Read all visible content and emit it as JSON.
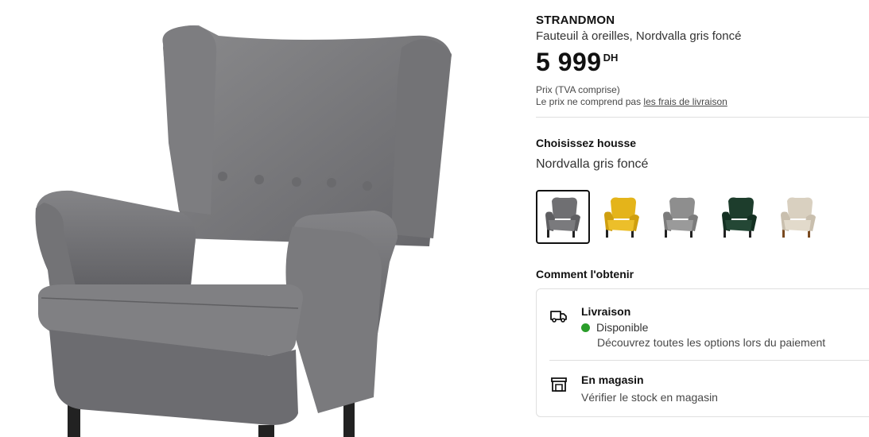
{
  "product": {
    "name": "STRANDMON",
    "description": "Fauteuil à oreilles, Nordvalla gris foncé",
    "price": {
      "amount": "5 999",
      "currency": "DH"
    },
    "vat_note": "Prix (TVA comprise)",
    "delivery_note": "Le prix ne comprend pas ",
    "delivery_link": "les frais de livraison"
  },
  "cover": {
    "title": "Choisissez housse",
    "selected": "Nordvalla gris foncé",
    "options": [
      {
        "color": "#6f6f72",
        "name": "grey"
      },
      {
        "color": "#e4b41a",
        "name": "yellow"
      },
      {
        "color": "#8e8e8e",
        "name": "light-grey"
      },
      {
        "color": "#1d3d2c",
        "name": "dark-green"
      },
      {
        "color": "#d9d0c0",
        "name": "beige"
      }
    ]
  },
  "availability": {
    "title": "Comment l'obtenir",
    "delivery": {
      "title": "Livraison",
      "status": "Disponible",
      "status_color": "#2a9d2a",
      "note": "Découvrez toutes les options lors du paiement",
      "icon": "truck-icon"
    },
    "store": {
      "title": "En magasin",
      "note": "Vérifier le stock en magasin",
      "icon": "store-icon"
    }
  }
}
